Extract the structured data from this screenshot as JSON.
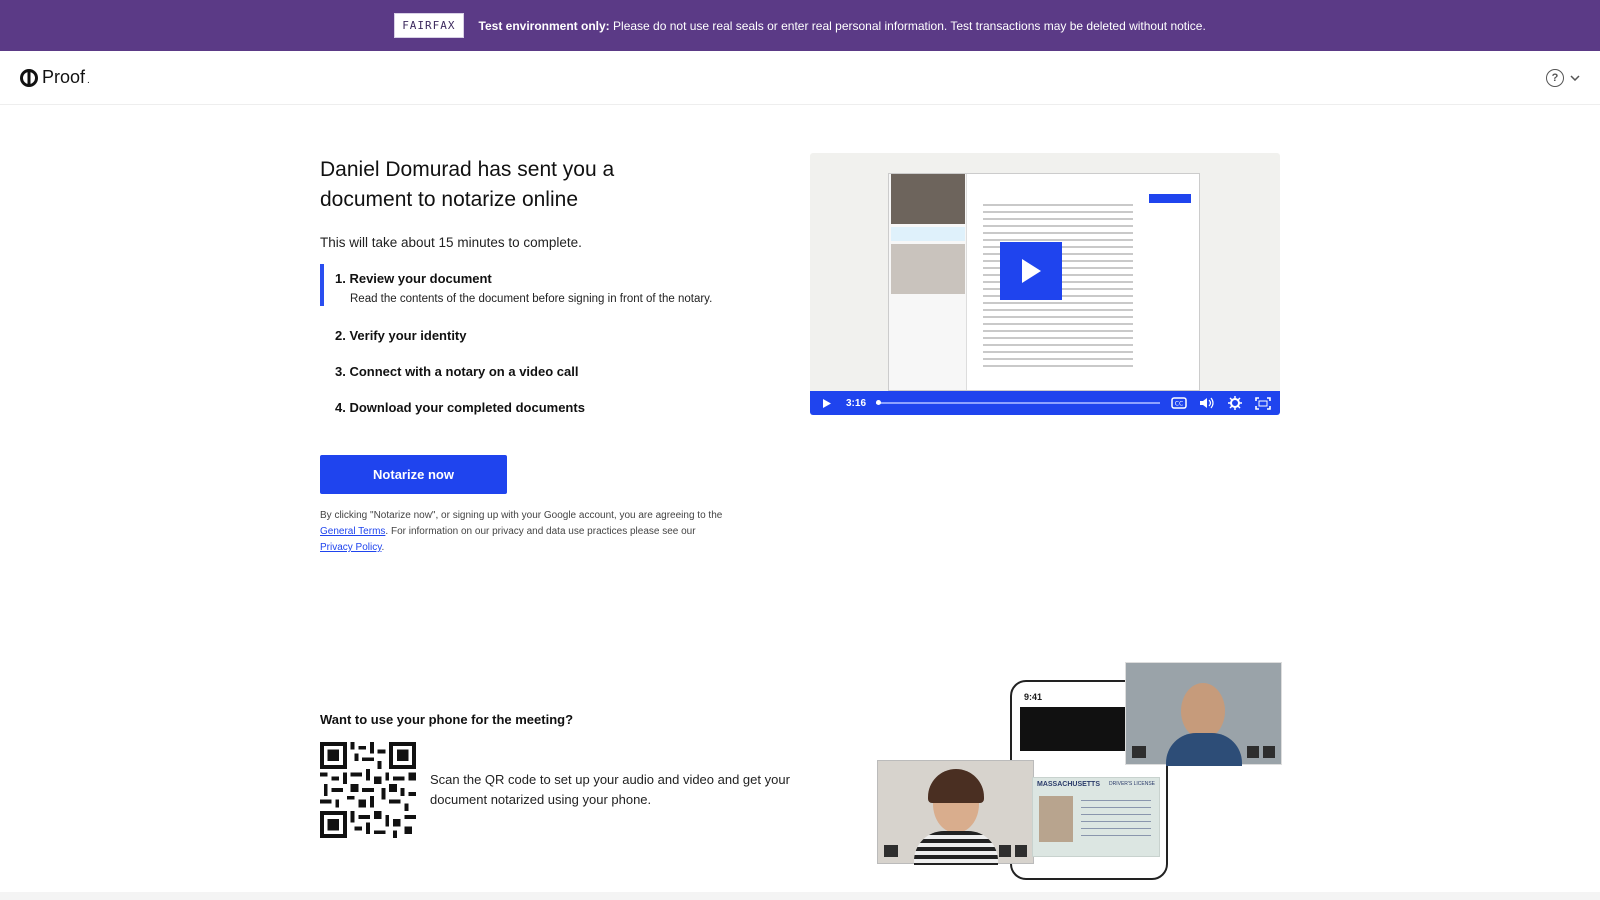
{
  "banner": {
    "logo": "FAIRFAX",
    "label": "Test environment only:",
    "message": " Please do not use real seals or enter real personal information. Test transactions may be deleted without notice."
  },
  "header": {
    "brand": "Proof",
    "brand_mark": ".",
    "help_icon": "question-circle-icon"
  },
  "main": {
    "title": "Daniel Domurad has sent you a document to notarize online",
    "duration": "This will take about 15 minutes to complete.",
    "steps": [
      {
        "title": "1. Review your document",
        "desc": "Read the contents of the document before signing in front of the notary."
      },
      {
        "title": "2. Verify your identity"
      },
      {
        "title": "3. Connect with a notary on a video call"
      },
      {
        "title": "4. Download your completed documents"
      }
    ],
    "cta_label": "Notarize now",
    "legal": {
      "part1": "By clicking \"Notarize now\", or signing up with your Google account, you are agreeing to the ",
      "terms_link": "General Terms",
      "part2": ". For information on our privacy and data use practices please see our ",
      "privacy_link": "Privacy Policy",
      "part3": "."
    }
  },
  "video": {
    "duration": "3:16",
    "controls": [
      "play-icon",
      "cc-icon",
      "volume-icon",
      "settings-icon",
      "fullscreen-icon"
    ]
  },
  "phone": {
    "title": "Want to use your phone for the meeting?",
    "description": "Scan the QR code to set up your audio and video and get your document notarized using your phone.",
    "phone_time": "9:41",
    "license_state": "MASSACHUSETTS",
    "license_type": "DRIVER'S LICENSE"
  },
  "colors": {
    "banner": "#5b3a86",
    "accent": "#1f44ee"
  }
}
